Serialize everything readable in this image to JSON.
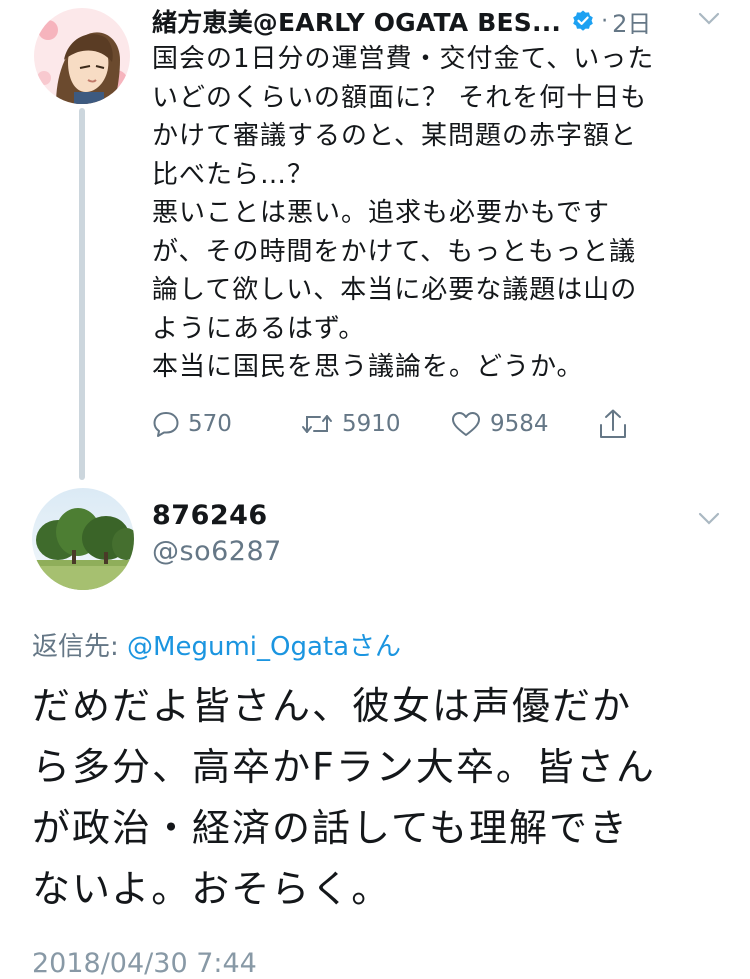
{
  "original_tweet": {
    "display_name": "緒方恵美@EARLY OGATA BES...",
    "verified_icon": "verified-badge-icon",
    "separator": "·",
    "time_ago": "2日",
    "body_lines": [
      "国会の1日分の運営費・交付金て、いった",
      "いどのくらいの額面に？ それを何十日も",
      "かけて審議するのと、某問題の赤字額と",
      "比べたら…？",
      "悪いことは悪い。追求も必要かもです",
      "が、その時間をかけて、もっともっと議",
      "論して欲しい、本当に必要な議題は山の",
      "ようにあるはず。",
      "本当に国民を思う議論を。どうか。"
    ],
    "actions": {
      "reply_count": "570",
      "retweet_count": "5910",
      "like_count": "9584"
    }
  },
  "reply_tweet": {
    "display_name": "876246",
    "handle": "@so6287",
    "reply_to_label": "返信先: ",
    "reply_to_mention": "@Megumi_Ogata",
    "reply_to_suffix": "さん",
    "body_lines": [
      "だめだよ皆さん、彼女は声優だか",
      "ら多分、高卒かFラン大卒。皆さん",
      "が政治・経済の話しても理解でき",
      "ないよ。おそらく。"
    ],
    "timestamp": "2018/04/30 7:44"
  },
  "colors": {
    "accent_blue": "#1b95e0",
    "muted_gray": "#657786",
    "thread_line": "#ccd6dd",
    "text": "#14171a"
  }
}
